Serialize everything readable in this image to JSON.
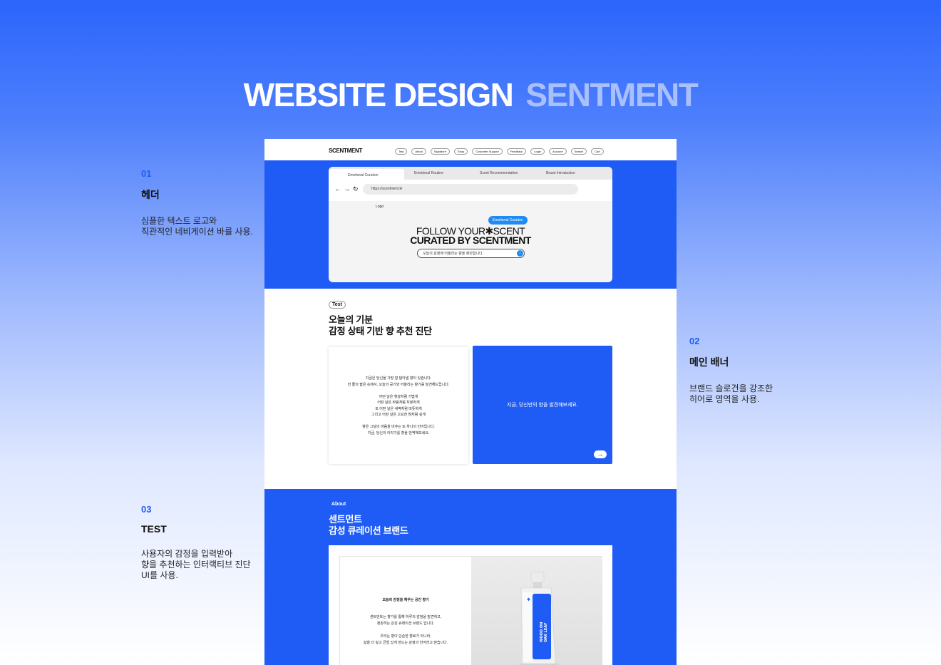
{
  "title": {
    "part1": "WEBSITE DESIGN",
    "part2": "SENTMENT"
  },
  "notes": [
    {
      "num": "01",
      "head": "헤더",
      "desc": "심플한 텍스트 로고와\n직관적인 네비게이션 바를 사용."
    },
    {
      "num": "02",
      "head": "메인 배너",
      "desc": "브랜드 슬로건을 강조한\n히어로 영역을 사용."
    },
    {
      "num": "03",
      "head": "TEST",
      "desc": "사용자의 감정을 입력받아\n향을 추천하는 인터랙티브 진단\nUI를 사용."
    }
  ],
  "site": {
    "logo": "SCENTMENT",
    "nav": [
      "Test",
      "About",
      "Signature",
      "Shop",
      "Customer Support",
      "Feedback",
      "Login",
      "Account",
      "Search",
      "Cart"
    ]
  },
  "browser": {
    "tabs": [
      "Emotional Curation",
      "Emotional Routine",
      "Scent Recommendation",
      "Brand Introduction"
    ],
    "nav_symbols": [
      "←",
      "→",
      "↻"
    ],
    "url": "https://scentment.kr",
    "logo": "Logo",
    "pill": "Emotional Curation",
    "headline_1a": "FOLLOW YOUR",
    "headline_star": "✱",
    "headline_1b": "SCENT",
    "headline_2": "CURATED BY SCENTMENT",
    "search_text": "오늘의 감정에 어울리는 향을 제안합니다.",
    "search_btn": "›"
  },
  "test": {
    "tag": "Test",
    "title": "오늘의 기분\n감정 상태 기반 향 추천 진단",
    "card_text": "지금은 당신을 가장 잘 닮아낼 향이 있습니다.\n한 줄의 짧은 속에서, 오늘의 공기와 어울리는 향기를 발견해드립니다.\n\n어떤 날은 햇살처럼 가볍게\n어떤 날은 바람처럼 차분하게\n또 어떤 날은 새벽처럼 따뜻하게\n그리고 어떤 날은 고요한 밤처럼 깊게\n\n향은 그날의 마음을 비추는 또 하나의 언어입니다.\n지금, 당신의 이야기를 향을 번역해보세요.",
    "cta": "지금, 당신만의 향을 발견해보세요.",
    "arrow": "→"
  },
  "about": {
    "tag": "About",
    "title": "센트먼트\n감성 큐레이션 브랜드",
    "heading": "오늘의 감정을 채우는 공간 향기",
    "body": "센트먼트는 향기를 통해 하루의 감정을 발견하고,\n정돈하는 감성 큐레이션 브랜드 입니다.\n\n우리는 향이 단순한 향료가 아니라,\n삶을 더 깊고 균형 있게 만드는 감정의 언어라고 믿습니다.",
    "bottle_text": "WOOD ON\nOAK LEAF"
  },
  "colors": {
    "accent": "#1f5cf5",
    "accent_light": "#a9c0fd",
    "pill": "#1f8bf3"
  }
}
